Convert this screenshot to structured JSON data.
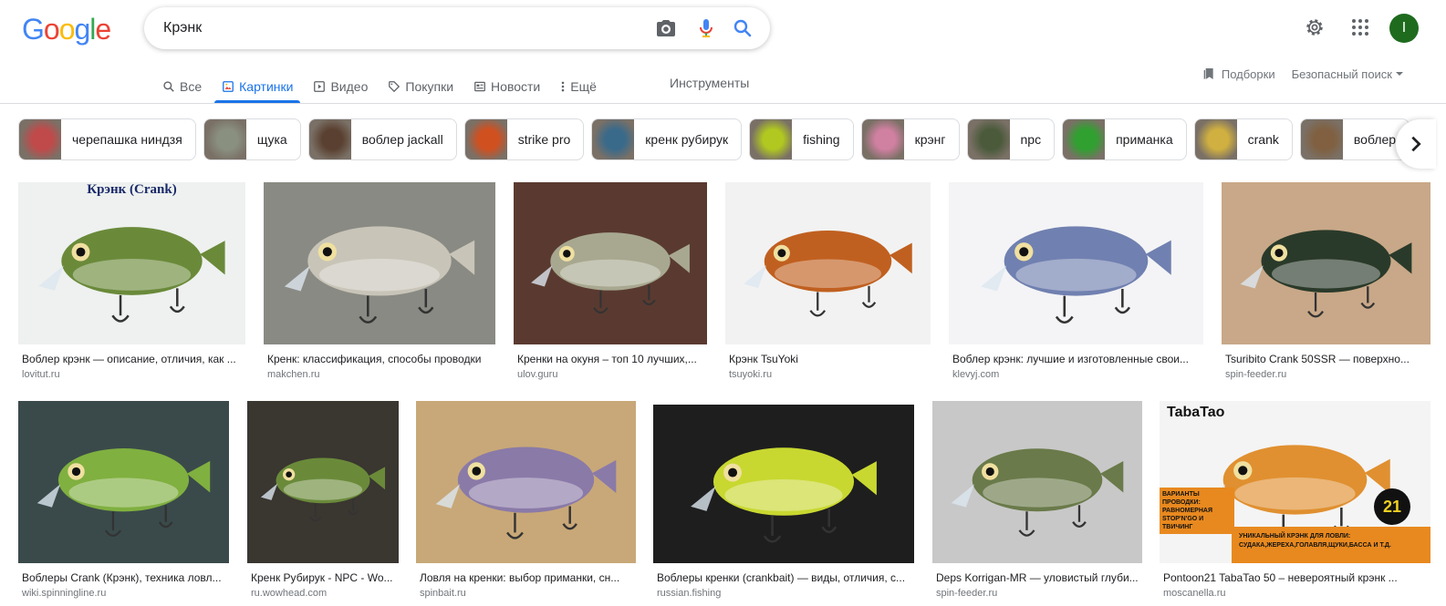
{
  "logo": {
    "letters": [
      "G",
      "o",
      "o",
      "g",
      "l",
      "e"
    ],
    "colors": [
      "#4285F4",
      "#EA4335",
      "#FBBC05",
      "#4285F4",
      "#34A853",
      "#EA4335"
    ]
  },
  "search": {
    "value": "Крэнк",
    "placeholder": ""
  },
  "avatar": {
    "initial": "I"
  },
  "tabs": [
    {
      "label": "Все",
      "icon": "search-icon",
      "active": false
    },
    {
      "label": "Картинки",
      "icon": "image-icon",
      "active": true
    },
    {
      "label": "Видео",
      "icon": "play-icon",
      "active": false
    },
    {
      "label": "Покупки",
      "icon": "tag-icon",
      "active": false
    },
    {
      "label": "Новости",
      "icon": "news-icon",
      "active": false
    },
    {
      "label": "Ещё",
      "icon": "more-vert-icon",
      "active": false
    }
  ],
  "tools_label": "Инструменты",
  "collections_label": "Подборки",
  "safesearch_label": "Безопасный поиск",
  "chips": [
    {
      "label": "черепашка ниндзя",
      "color": "#c04a4a"
    },
    {
      "label": "щука",
      "color": "#8a9080"
    },
    {
      "label": "воблер jackall",
      "color": "#5a4030"
    },
    {
      "label": "strike pro",
      "color": "#d05020"
    },
    {
      "label": "кренк рубирук",
      "color": "#3a6a8a"
    },
    {
      "label": "fishing",
      "color": "#b0c820"
    },
    {
      "label": "крэнг",
      "color": "#d080a0"
    },
    {
      "label": "npc",
      "color": "#4a5a3a"
    },
    {
      "label": "приманка",
      "color": "#30a030"
    },
    {
      "label": "crank",
      "color": "#d0b040"
    },
    {
      "label": "воблер",
      "color": "#806040"
    }
  ],
  "results": [
    {
      "caption": "Воблер крэнк — описание, отличия, как ...",
      "source": "lovitut.ru",
      "bg": "#eef1ef",
      "fg": "#6a8a3a"
    },
    {
      "caption": "Кренк: классификация, способы проводки",
      "source": "makchen.ru",
      "bg": "#8a8a84",
      "fg": "#c8c4b8"
    },
    {
      "caption": "Кренки на окуня – топ 10 лучших,...",
      "source": "ulov.guru",
      "bg": "#5a3a30",
      "fg": "#a8a890"
    },
    {
      "caption": "Крэнк TsuYoki",
      "source": "tsuyoki.ru",
      "bg": "#f2f2f2",
      "fg": "#c06020"
    },
    {
      "caption": "Воблер крэнк: лучшие и изготовленные свои...",
      "source": "klevyj.com",
      "bg": "#f4f4f6",
      "fg": "#7080b0"
    },
    {
      "caption": "Tsuribito Crank 50SSR — поверхно...",
      "source": "spin-feeder.ru",
      "bg": "#c8a888",
      "fg": "#2a3a2a"
    },
    {
      "caption": "Воблеры Crank (Крэнк), техника ловл...",
      "source": "wiki.spinningline.ru",
      "bg": "#3a4a4a",
      "fg": "#80b040"
    },
    {
      "caption": "Кренк Рубирук - NPC - Wo...",
      "source": "ru.wowhead.com",
      "bg": "#3a3630",
      "fg": "#6a8a3a"
    },
    {
      "caption": "Ловля на кренки: выбор приманки, сн...",
      "source": "spinbait.ru",
      "bg": "#c8a878",
      "fg": "#8a7aa8"
    },
    {
      "caption": "Воблеры кренки (crankbait) — виды, отличия, с...",
      "source": "russian.fishing",
      "bg": "#1e1e1e",
      "fg": "#c8d830"
    },
    {
      "caption": "Deps Korrigan-MR — уловистый глуби...",
      "source": "spin-feeder.ru",
      "bg": "#c8c8c8",
      "fg": "#6a7a4a"
    },
    {
      "caption": "Pontoon21 TabaTao 50 – невероятный крэнк ...",
      "source": "moscanella.ru",
      "bg": "#f4f4f4",
      "fg": "#e09030"
    }
  ],
  "result_texts": {
    "r0_title": "Крэнк (Crank)",
    "r11_brand": "TabaTao",
    "r11_banner1": "ВАРИАНТЫ ПРОВОДКИ: РАВНОМЕРНАЯ STOP'N'GO И ТВИЧИНГ",
    "r11_banner2": "УНИКАЛЬНЫЙ КРЭНК ДЛЯ ЛОВЛИ: СУДАКА,ЖЕРЕХА,ГОЛАВЛЯ,ЩУКИ,БАССА И Т.Д.",
    "r11_badge": "21"
  }
}
